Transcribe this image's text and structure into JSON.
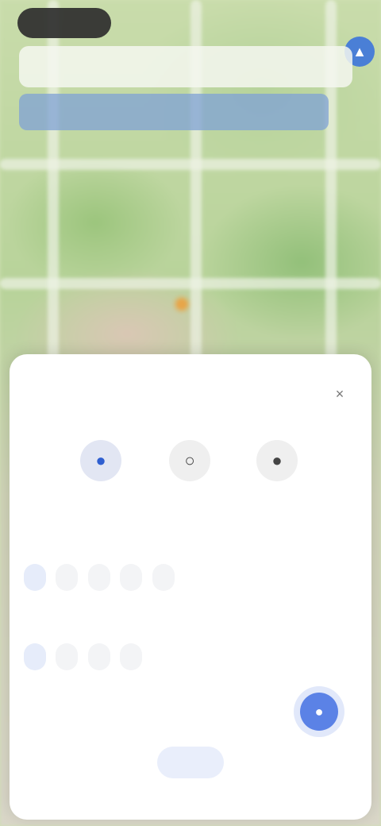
{
  "map": {
    "pin_icon": "location-pin-icon"
  },
  "top": {
    "time": "",
    "menu_icon": "layers-icon"
  },
  "route_card": {
    "label": ""
  },
  "route_bar": {
    "label": ""
  },
  "sheet": {
    "title": "",
    "close_icon": "×",
    "modes": [
      {
        "icon": "●",
        "label": "",
        "active": true
      },
      {
        "icon": "○",
        "label": "",
        "active": false
      },
      {
        "icon": "●",
        "label": "",
        "active": false
      }
    ],
    "section1": {
      "label": "",
      "chips": [
        "",
        "",
        "",
        "",
        ""
      ]
    },
    "section2": {
      "label": "",
      "chips": [
        "",
        "",
        "",
        ""
      ]
    },
    "toggle_row": {
      "label": "",
      "toggle_icon": "●"
    },
    "done_label": ""
  },
  "colors": {
    "accent": "#2f5fd0",
    "toggle": "#5b82e6"
  }
}
